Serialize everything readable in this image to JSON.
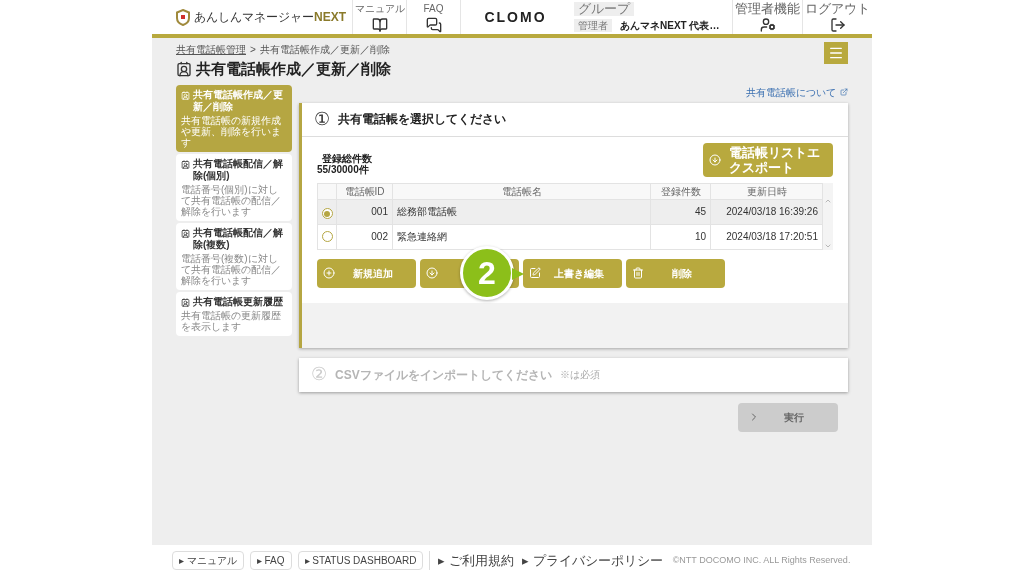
{
  "header": {
    "brand": "あんしんマネージャー",
    "brand_suffix": "NEXT",
    "nav": [
      {
        "label": "マニュアル",
        "kind": "book"
      },
      {
        "label": "FAQ",
        "kind": "chat"
      }
    ],
    "center_logo": "CLOMO",
    "group_label": "グループ",
    "admin_label": "管理者",
    "admin_name": "あんマネNEXT 代表…",
    "right_nav": [
      {
        "label": "管理者機能",
        "kind": "user-gear"
      },
      {
        "label": "ログアウト",
        "kind": "logout"
      }
    ]
  },
  "breadcrumb": [
    {
      "label": "共有電話帳管理",
      "link": true
    },
    {
      "label": "共有電話帳作成／更新／削除",
      "link": false
    }
  ],
  "breadcrumb_separator": ">",
  "page_title": "共有電話帳作成／更新／削除",
  "help_link": "共有電話帳について",
  "sidebar": [
    {
      "title": "共有電話帳作成／更新／削除",
      "desc": "共有電話帳の新規作成や更新、削除を行います",
      "selected": true
    },
    {
      "title": "共有電話帳配信／解除(個別)",
      "desc": "電話番号(個別)に対して共有電話帳の配信／解除を行います",
      "selected": false
    },
    {
      "title": "共有電話帳配信／解除(複数)",
      "desc": "電話番号(複数)に対して共有電話帳の配信／解除を行います",
      "selected": false
    },
    {
      "title": "共有電話帳更新履歴",
      "desc": "共有電話帳の更新履歴を表示します",
      "selected": false
    }
  ],
  "step1": {
    "number": "①",
    "title": "共有電話帳を選択してください",
    "count_label": "登録総件数",
    "count_value": "55/30000件",
    "export_button": "電話帳リストエクスポート",
    "table": {
      "columns": [
        "電話帳ID",
        "電話帳名",
        "登録件数",
        "更新日時"
      ],
      "rows": [
        {
          "id": "001",
          "name": "総務部電話帳",
          "count": "45",
          "updated": "2024/03/18 16:39:26",
          "selected": true
        },
        {
          "id": "002",
          "name": "緊急連絡網",
          "count": "10",
          "updated": "2024/03/18 17:20:51",
          "selected": false
        }
      ]
    },
    "buttons": [
      {
        "label": "新規追加",
        "kind": "add"
      },
      {
        "kind": "import"
      },
      {
        "label": "上書き編集",
        "kind": "edit"
      },
      {
        "label": "削除",
        "kind": "delete"
      }
    ]
  },
  "callout": "2",
  "step2": {
    "number": "②",
    "title": "CSVファイルをインポートしてください",
    "note": "※は必須",
    "disabled": true
  },
  "run_button": {
    "label": "実行",
    "disabled": true
  },
  "footer": {
    "bullet": "▸",
    "buttons": [
      "マニュアル",
      "FAQ",
      "STATUS DASHBOARD"
    ],
    "links": [
      "ご利用規約",
      "プライバシーポリシー"
    ],
    "copyright": "©NTT DOCOMO INC. ALL Rights Reserved."
  }
}
